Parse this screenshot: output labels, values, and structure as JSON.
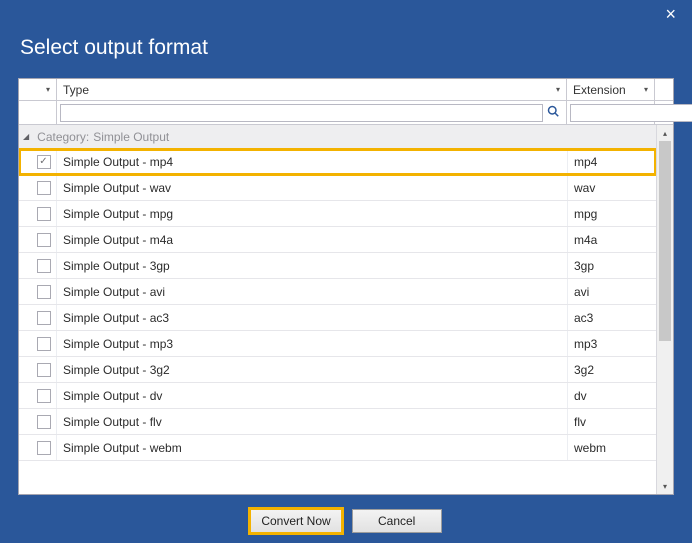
{
  "title": "Select output format",
  "columns": {
    "type": "Type",
    "extension": "Extension"
  },
  "category_prefix": "Category:",
  "category_name": "Simple Output",
  "rows": [
    {
      "type": "Simple Output - mp4",
      "ext": "mp4",
      "checked": true,
      "selected": true
    },
    {
      "type": "Simple Output - wav",
      "ext": "wav",
      "checked": false,
      "selected": false
    },
    {
      "type": "Simple Output - mpg",
      "ext": "mpg",
      "checked": false,
      "selected": false
    },
    {
      "type": "Simple Output - m4a",
      "ext": "m4a",
      "checked": false,
      "selected": false
    },
    {
      "type": "Simple Output - 3gp",
      "ext": "3gp",
      "checked": false,
      "selected": false
    },
    {
      "type": "Simple Output - avi",
      "ext": "avi",
      "checked": false,
      "selected": false
    },
    {
      "type": "Simple Output - ac3",
      "ext": "ac3",
      "checked": false,
      "selected": false
    },
    {
      "type": "Simple Output - mp3",
      "ext": "mp3",
      "checked": false,
      "selected": false
    },
    {
      "type": "Simple Output - 3g2",
      "ext": "3g2",
      "checked": false,
      "selected": false
    },
    {
      "type": "Simple Output - dv",
      "ext": "dv",
      "checked": false,
      "selected": false
    },
    {
      "type": "Simple Output - flv",
      "ext": "flv",
      "checked": false,
      "selected": false
    },
    {
      "type": "Simple Output - webm",
      "ext": "webm",
      "checked": false,
      "selected": false
    }
  ],
  "buttons": {
    "convert": "Convert Now",
    "cancel": "Cancel"
  }
}
